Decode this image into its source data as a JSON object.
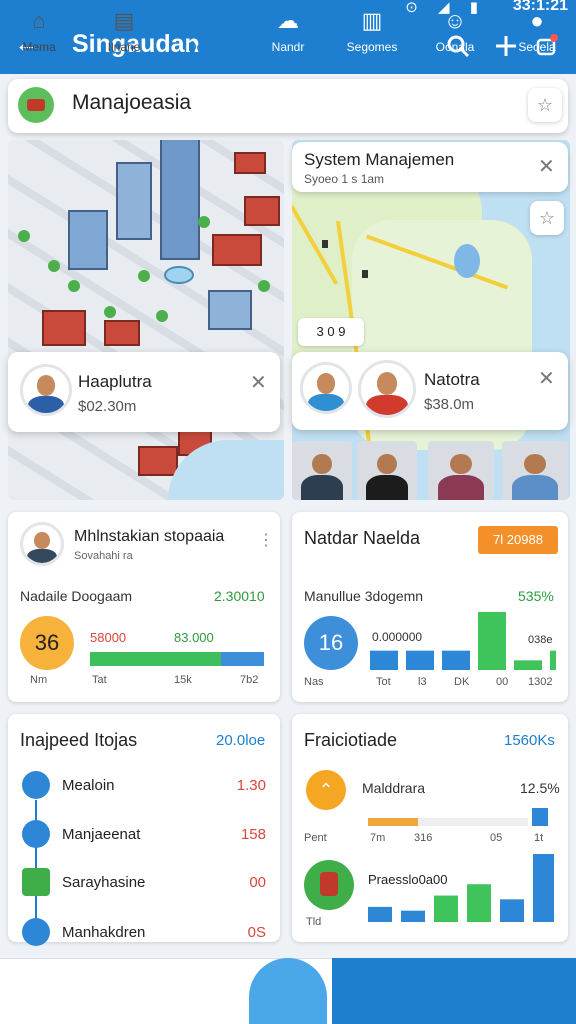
{
  "statusbar": {
    "time": "33:1:21",
    "icons": "⊙ ◢ ▮"
  },
  "appbar": {
    "back_icon": "←",
    "title": "Singaudan",
    "actions": [
      "search-icon",
      "add-icon",
      "settings-icon"
    ]
  },
  "search": {
    "value": "Manajoeasia"
  },
  "system_card": {
    "title": "System Manajemen",
    "subtitle": "Syoeo 1 s 1am"
  },
  "map_counter": "3 0 9",
  "popover_left": {
    "name": "Haaplutra",
    "sub": "$02.30m"
  },
  "popover_right": {
    "name": "Natotra",
    "sub": "$38.0m"
  },
  "card1": {
    "title": "Mhlnstakian stopaaia",
    "subtitle": "Sovahahi ra",
    "metric_label": "Nadaile Doogaam",
    "metric_value": "2.30010",
    "circle_value": "36",
    "bar_a_label": "58000",
    "bar_b_label": "83.000",
    "bar_fill": 0.75,
    "ticks": [
      "Nm",
      "Tat",
      "15k",
      "7b2"
    ]
  },
  "card2": {
    "title": "Natdar Naelda",
    "badge": "7l 20988",
    "metric_label": "Manullue 3dogemn",
    "metric_value": "535%",
    "circle_value": "16",
    "bar_top_label": "0.000000",
    "bar_side_label": "038e",
    "bars": [
      {
        "value": 3,
        "color": "#2d86d6"
      },
      {
        "value": 3,
        "color": "#2d86d6"
      },
      {
        "value": 3,
        "color": "#2d86d6"
      },
      {
        "value": 9,
        "color": "#3fc35b"
      },
      {
        "value": 1.5,
        "color": "#3fc35b"
      },
      {
        "value": 3,
        "color": "#3fc35b"
      }
    ],
    "ticks": [
      "Nas",
      "Tot",
      "l3",
      "DK",
      "00",
      "1302"
    ]
  },
  "card3": {
    "title": "Inajpeed Itojas",
    "right_value": "20.0loe",
    "items": [
      {
        "label": "Mealoin",
        "value": "1.30",
        "icon": "drop-icon",
        "color": "#2d86d6"
      },
      {
        "label": "Manjaeenat",
        "value": "158",
        "icon": "folder-icon",
        "color": "#2d86d6"
      },
      {
        "label": "Sarayhasine",
        "value": "00",
        "icon": "warning-icon",
        "color": "#3fae49"
      },
      {
        "label": "Manhakdren",
        "value": "0S",
        "icon": "badge-icon",
        "color": "#2d86d6"
      }
    ]
  },
  "card4": {
    "title": "Fraiciotiade",
    "right_value": "1560Ks",
    "row1_label": "Malddrara",
    "row1_pct": "12.5%",
    "row1_ticks": [
      "Pent",
      "7m",
      "316",
      "05",
      "1t"
    ],
    "row2_label": "Praesslo0a00",
    "bars": [
      {
        "value": 2,
        "color": "#2d86d6"
      },
      {
        "value": 1.5,
        "color": "#2d86d6"
      },
      {
        "value": 3.5,
        "color": "#3fc35b"
      },
      {
        "value": 5,
        "color": "#3fc35b"
      },
      {
        "value": 3,
        "color": "#2d86d6"
      },
      {
        "value": 9,
        "color": "#2d86d6"
      }
    ],
    "row2_tick": "Tld"
  },
  "nav": [
    {
      "label": "Mema",
      "icon": "home-icon"
    },
    {
      "label": "Ilnane",
      "icon": "document-icon"
    },
    {
      "label": "Doaena",
      "icon": "people-icon"
    },
    {
      "label": "Nandr",
      "icon": "cloud-icon"
    },
    {
      "label": "Segomes",
      "icon": "chart-icon"
    },
    {
      "label": "Oonala",
      "icon": "chat-icon"
    },
    {
      "label": "Seoela",
      "icon": "user-icon"
    }
  ]
}
